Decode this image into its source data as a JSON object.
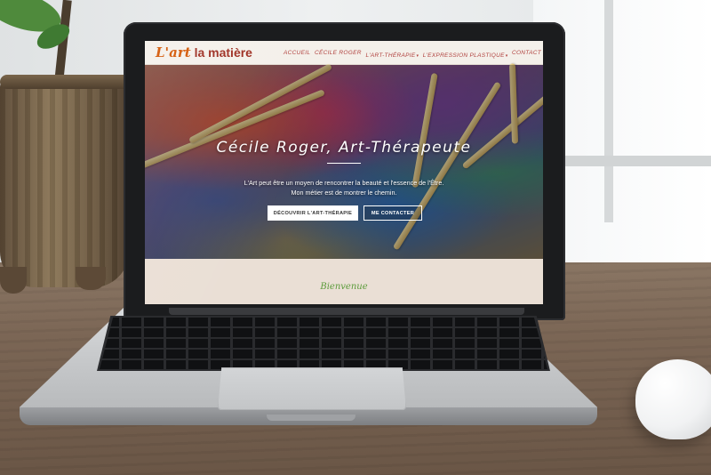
{
  "site": {
    "logo": {
      "part_a": "L'art",
      "part_b": " la matière"
    },
    "nav": [
      {
        "label": "Accueil",
        "has_dropdown": false
      },
      {
        "label": "Cécile Roger",
        "has_dropdown": false
      },
      {
        "label": "L'Art-thérapie",
        "has_dropdown": true
      },
      {
        "label": "L'expression plastique",
        "has_dropdown": true
      },
      {
        "label": "Contact",
        "has_dropdown": false
      }
    ],
    "hero": {
      "title": "Cécile Roger, Art-Thérapeute",
      "text_line1": "L'Art peut être un moyen de rencontrer la beauté et l'essence de l'Être.",
      "text_line2": "Mon métier est de montrer le chemin.",
      "primary_button": "Découvrir l'Art-thérapie",
      "secondary_button": "Me contacter"
    },
    "welcome": {
      "title": "Bienvenue"
    },
    "colors": {
      "nav_link": "#b0413e",
      "welcome_title": "#5b9b3a",
      "page_bg": "#eadfd5"
    }
  }
}
